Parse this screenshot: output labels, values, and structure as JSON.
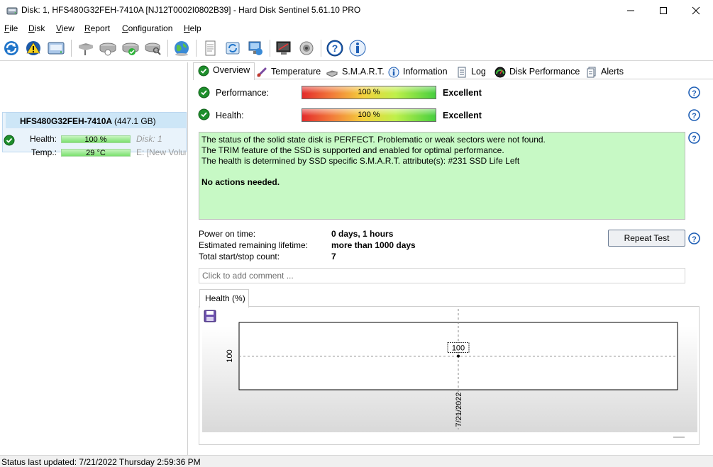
{
  "window": {
    "title": "Disk: 1, HFS480G32FEH-7410A [NJ12T0002I0802B39]  -  Hard Disk Sentinel 5.61.10 PRO",
    "controls": {
      "minimize": "minimize-icon",
      "maximize": "maximize-icon",
      "close": "close-icon"
    }
  },
  "menu": [
    {
      "underline": "F",
      "rest": "ile"
    },
    {
      "underline": "D",
      "rest": "isk"
    },
    {
      "underline": "V",
      "rest": "iew"
    },
    {
      "underline": "R",
      "rest": "eport"
    },
    {
      "underline": "C",
      "rest": "onfiguration"
    },
    {
      "underline": "H",
      "rest": "elp"
    }
  ],
  "toolbar": {
    "icons": [
      "refresh-icon",
      "alert-warning-icon",
      "disk-info-icon",
      "surface-test-icon",
      "disk-test-icon",
      "disk-ok-icon",
      "disk-search-icon",
      "web-globe-icon",
      "report-icon",
      "update-icon",
      "network-icon",
      "monitor-icon",
      "sound-icon",
      "help-icon",
      "about-icon"
    ]
  },
  "disk_card": {
    "model": "HFS480G32FEH-7410A",
    "capacity": "(447.1 GB)",
    "health_label": "Health:",
    "health_value": "100 %",
    "temp_label": "Temp.:",
    "temp_value": "29 °C",
    "disk_index": "Disk: 1",
    "volume": "E: [New Volume]"
  },
  "tabs": [
    {
      "label": "Overview",
      "icon": "check-circle-icon",
      "active": true
    },
    {
      "label": "Temperature",
      "icon": "thermometer-icon"
    },
    {
      "label": "S.M.A.R.T.",
      "icon": "smart-disk-icon"
    },
    {
      "label": "Information",
      "icon": "info-icon"
    },
    {
      "label": "Log",
      "icon": "log-document-icon"
    },
    {
      "label": "Disk Performance",
      "icon": "gauge-icon"
    },
    {
      "label": "Alerts",
      "icon": "alerts-document-icon"
    }
  ],
  "overview": {
    "performance": {
      "label": "Performance:",
      "value": "100 %",
      "rating": "Excellent",
      "level": 1.0
    },
    "health": {
      "label": "Health:",
      "value": "100 %",
      "rating": "Excellent",
      "level": 1.0
    },
    "status_lines": [
      "The status of the solid state disk is PERFECT. Problematic or weak sectors were not found.",
      "The TRIM feature of the SSD is supported and enabled for optimal performance.",
      "The health is determined by SSD specific S.M.A.R.T. attribute(s):  #231 SSD Life Left"
    ],
    "status_action": "No actions needed.",
    "power_on_label": "Power on time:",
    "power_on_value": "0 days, 1 hours",
    "lifetime_label": "Estimated remaining lifetime:",
    "lifetime_value": "more than 1000 days",
    "startstop_label": "Total start/stop count:",
    "startstop_value": "7",
    "repeat_button": "Repeat Test",
    "comment_placeholder": "Click to add comment ..."
  },
  "chart_tab_label": "Health (%)",
  "chart_data": {
    "type": "line",
    "x": [
      "7/21/2022"
    ],
    "values": [
      100
    ],
    "ylabel": "",
    "xlabel": "",
    "y_tick_label": "100",
    "point_label": "100",
    "grid": true
  },
  "statusbar": {
    "text": "Status last updated: 7/21/2022 Thursday 2:59:36 PM"
  }
}
